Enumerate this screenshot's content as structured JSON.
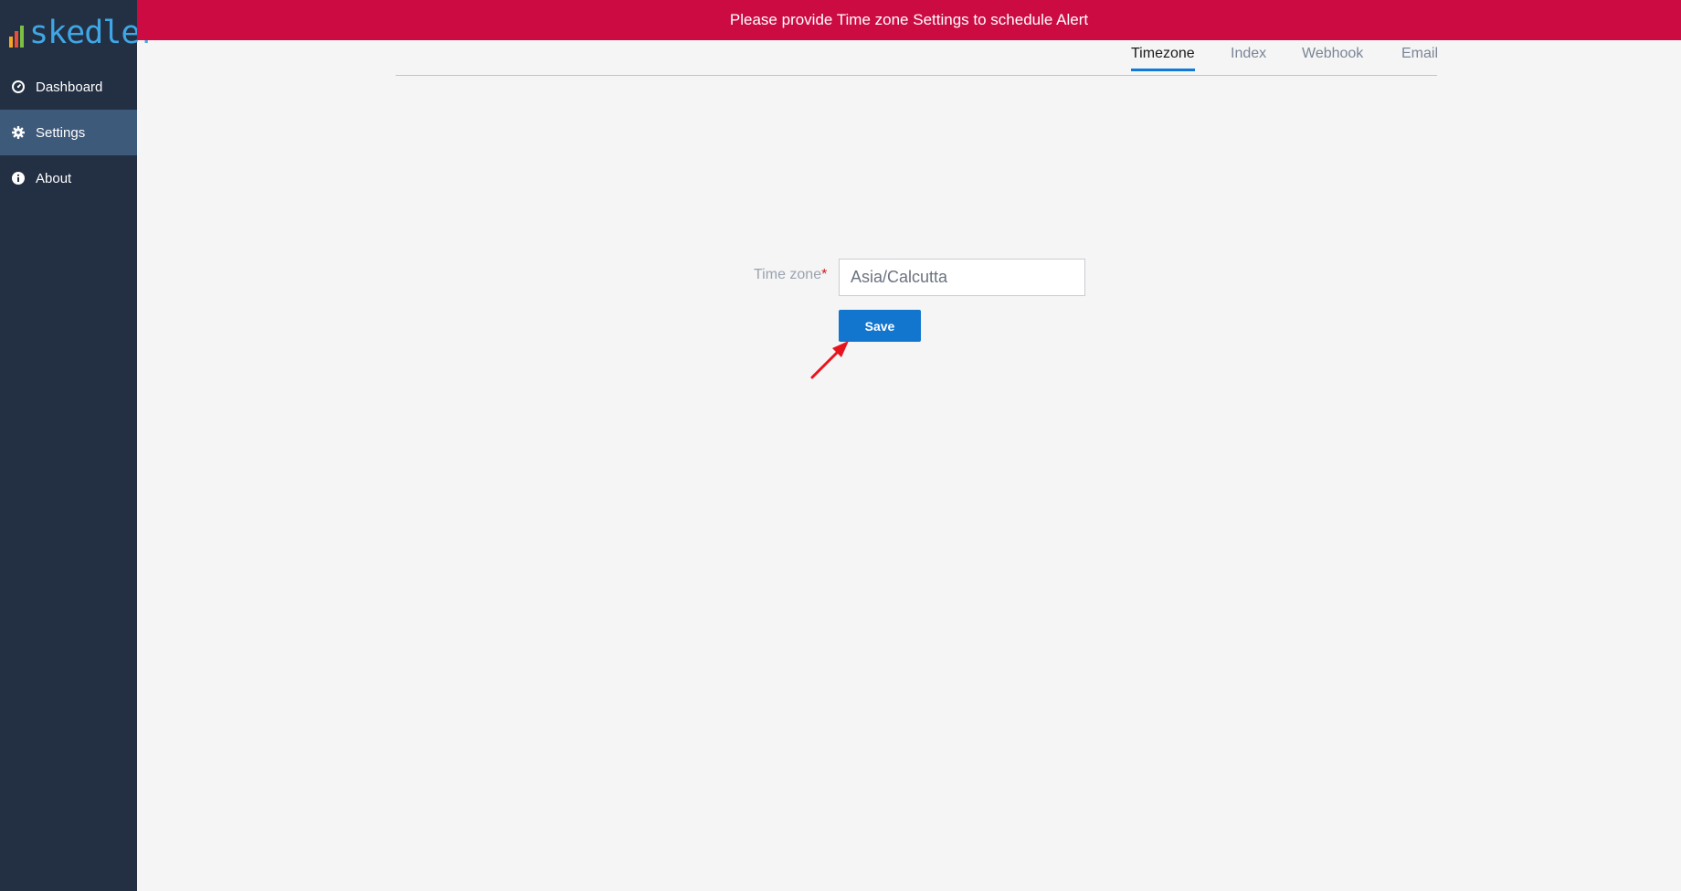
{
  "app": {
    "logo_text": "skedler",
    "logo_colors": [
      "#f5a623",
      "#e94e3d",
      "#7bc043",
      "#3fa7e6"
    ]
  },
  "sidebar": {
    "items": [
      {
        "label": "Dashboard",
        "icon": "dashboard-icon",
        "active": false
      },
      {
        "label": "Settings",
        "icon": "gear-icon",
        "active": true
      },
      {
        "label": "About",
        "icon": "info-icon",
        "active": false
      }
    ]
  },
  "banner": {
    "message": "Please provide Time zone Settings to schedule Alert",
    "color": "#cc0b43"
  },
  "tabs": [
    {
      "label": "Timezone",
      "active": true
    },
    {
      "label": "Index",
      "active": false
    },
    {
      "label": "Webhook",
      "active": false
    },
    {
      "label": "Email",
      "active": false
    }
  ],
  "form": {
    "timezone_label": "Time zone",
    "required_marker": "*",
    "timezone_value": "Asia/Calcutta",
    "save_label": "Save"
  },
  "colors": {
    "accent": "#1276cf",
    "sidebar_bg": "#232f42",
    "sidebar_active": "#3e5a7a",
    "annotation_arrow": "#e8141d"
  }
}
